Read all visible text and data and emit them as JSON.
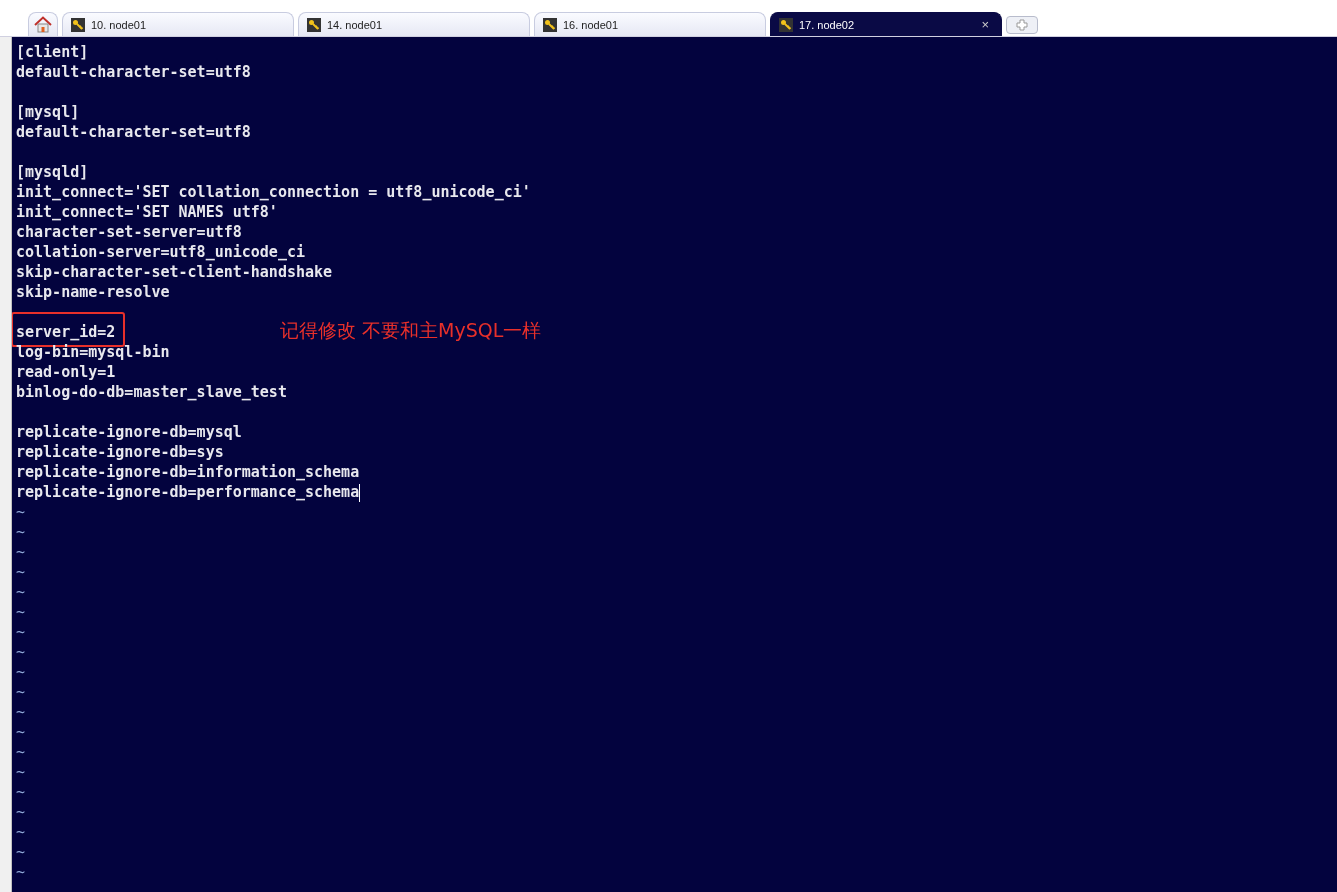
{
  "tabs": [
    {
      "kind": "home",
      "selected": false
    },
    {
      "kind": "session",
      "label": "10. node01",
      "selected": false
    },
    {
      "kind": "session",
      "label": "14. node01",
      "selected": false
    },
    {
      "kind": "session",
      "label": "16. node01",
      "selected": false
    },
    {
      "kind": "session",
      "label": "17. node02",
      "selected": true,
      "close": "×"
    }
  ],
  "terminal": {
    "lines": [
      {
        "kind": "text",
        "text": "[client]"
      },
      {
        "kind": "text",
        "text": "default-character-set=utf8"
      },
      {
        "kind": "blank"
      },
      {
        "kind": "text",
        "text": "[mysql]"
      },
      {
        "kind": "text",
        "text": "default-character-set=utf8"
      },
      {
        "kind": "blank"
      },
      {
        "kind": "text",
        "text": "[mysqld]"
      },
      {
        "kind": "text",
        "text": "init_connect='SET collation_connection = utf8_unicode_ci'"
      },
      {
        "kind": "text",
        "text": "init_connect='SET NAMES utf8'"
      },
      {
        "kind": "text",
        "text": "character-set-server=utf8"
      },
      {
        "kind": "text",
        "text": "collation-server=utf8_unicode_ci"
      },
      {
        "kind": "text",
        "text": "skip-character-set-client-handshake"
      },
      {
        "kind": "text",
        "text": "skip-name-resolve"
      },
      {
        "kind": "blank"
      },
      {
        "kind": "text",
        "text": "server_id=2",
        "boxed": true,
        "annotation": "记得修改 不要和主MySQL一样"
      },
      {
        "kind": "text",
        "text": "log-bin=mysql-bin"
      },
      {
        "kind": "text",
        "text": "read-only=1"
      },
      {
        "kind": "text",
        "text": "binlog-do-db=master_slave_test"
      },
      {
        "kind": "blank"
      },
      {
        "kind": "text",
        "text": "replicate-ignore-db=mysql"
      },
      {
        "kind": "text",
        "text": "replicate-ignore-db=sys"
      },
      {
        "kind": "text",
        "text": "replicate-ignore-db=information_schema"
      },
      {
        "kind": "text",
        "text": "replicate-ignore-db=performance_schema",
        "cursor": true
      },
      {
        "kind": "tilde",
        "text": "~"
      },
      {
        "kind": "tilde",
        "text": "~"
      },
      {
        "kind": "tilde",
        "text": "~"
      },
      {
        "kind": "tilde",
        "text": "~"
      },
      {
        "kind": "tilde",
        "text": "~"
      },
      {
        "kind": "tilde",
        "text": "~"
      },
      {
        "kind": "tilde",
        "text": "~"
      },
      {
        "kind": "tilde",
        "text": "~"
      },
      {
        "kind": "tilde",
        "text": "~"
      },
      {
        "kind": "tilde",
        "text": "~"
      },
      {
        "kind": "tilde",
        "text": "~"
      },
      {
        "kind": "tilde",
        "text": "~"
      },
      {
        "kind": "tilde",
        "text": "~"
      },
      {
        "kind": "tilde",
        "text": "~"
      },
      {
        "kind": "tilde",
        "text": "~"
      },
      {
        "kind": "tilde",
        "text": "~"
      },
      {
        "kind": "tilde",
        "text": "~"
      },
      {
        "kind": "tilde",
        "text": "~"
      },
      {
        "kind": "tilde",
        "text": "~"
      }
    ]
  }
}
